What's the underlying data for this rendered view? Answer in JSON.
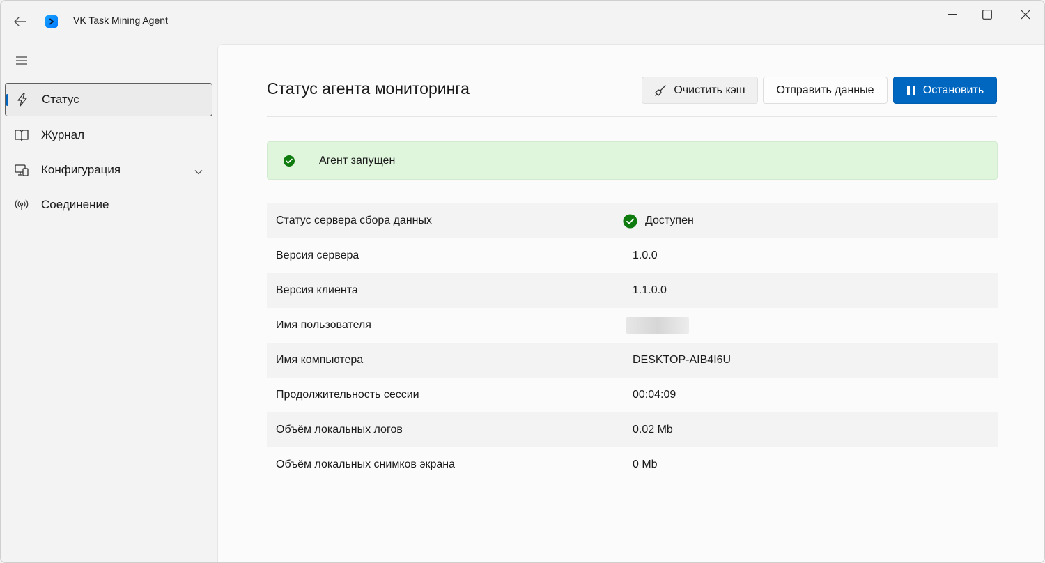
{
  "app": {
    "title": "VK Task Mining Agent"
  },
  "sidebar": {
    "items": [
      {
        "label": "Статус",
        "icon": "lightning-icon",
        "active": true
      },
      {
        "label": "Журнал",
        "icon": "book-icon"
      },
      {
        "label": "Конфигурация",
        "icon": "computer-settings-icon",
        "expandable": true
      },
      {
        "label": "Соединение",
        "icon": "antenna-icon"
      }
    ]
  },
  "page": {
    "title": "Статус агента мониторинга",
    "buttons": {
      "clear_cache": "Очистить кэш",
      "send_data": "Отправить данные",
      "stop": "Остановить"
    },
    "status_banner": "Агент запущен"
  },
  "info": {
    "rows": [
      {
        "label": "Статус сервера сбора данных",
        "value": "Доступен"
      },
      {
        "label": "Версия сервера",
        "value": "1.0.0"
      },
      {
        "label": "Версия клиента",
        "value": "1.1.0.0"
      },
      {
        "label": "Имя пользователя",
        "value": ""
      },
      {
        "label": "Имя компьютера",
        "value": "DESKTOP-AIB4I6U"
      },
      {
        "label": "Продолжительность сессии",
        "value": "00:04:09"
      },
      {
        "label": "Объём локальных логов",
        "value": "0.02 Mb"
      },
      {
        "label": "Объём локальных снимков экрана",
        "value": "0 Mb"
      }
    ]
  },
  "colors": {
    "accent": "#0067c0",
    "success": "#0f7b0f",
    "success_bg": "#dff6dd"
  }
}
